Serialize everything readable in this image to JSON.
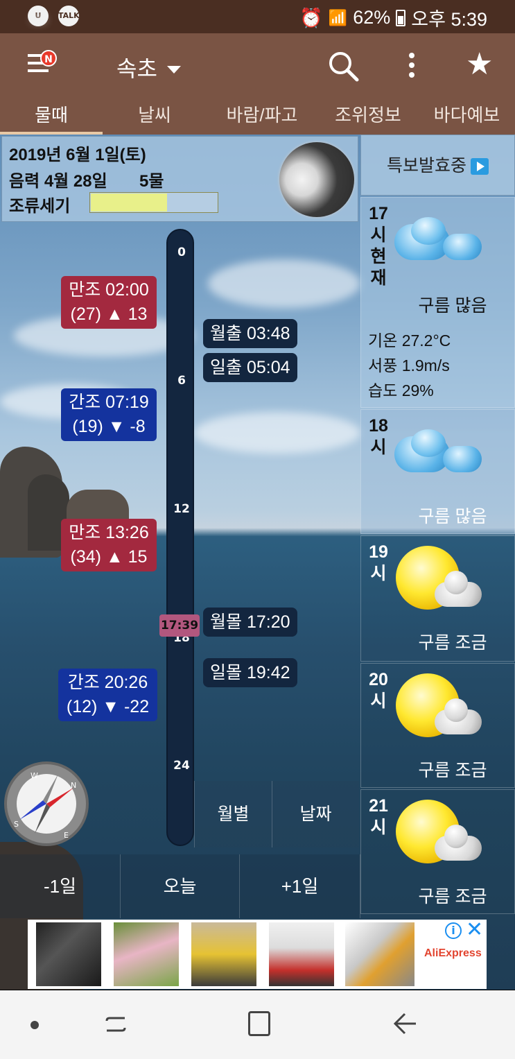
{
  "status_bar": {
    "left_icons": [
      "U",
      "cloud",
      "TALK"
    ],
    "battery": "62%",
    "time": "오후 5:39"
  },
  "app_bar": {
    "badge": "N",
    "location": "속초"
  },
  "tabs": [
    {
      "label": "물때",
      "active": true
    },
    {
      "label": "날씨"
    },
    {
      "label": "바람/파고"
    },
    {
      "label": "조위정보"
    },
    {
      "label": "바다예보"
    }
  ],
  "info": {
    "date": "2019년 6월 1일(토)",
    "lunar": "음력 4월 28일",
    "tide_phase": "5물",
    "strength_label": "조류세기",
    "strength_fraction": 0.6
  },
  "timeline": {
    "ticks": [
      "0",
      "6",
      "12",
      "18",
      "24"
    ],
    "now": "17:39"
  },
  "tides": [
    {
      "type": "high",
      "line1": "만조 02:00",
      "line2": "(27) ▲ 13"
    },
    {
      "type": "low",
      "line1": "간조 07:19",
      "line2": "(19) ▼ -8"
    },
    {
      "type": "high",
      "line1": "만조 13:26",
      "line2": "(34) ▲ 15"
    },
    {
      "type": "low",
      "line1": "간조 20:26",
      "line2": "(12) ▼ -22"
    }
  ],
  "astro": [
    "월출 03:48",
    "일출 05:04",
    "월몰 17:20",
    "일몰 19:42"
  ],
  "side_buttons": {
    "monthly": "월별",
    "date": "날짜"
  },
  "day_nav": {
    "prev": "-1일",
    "today": "오늘",
    "next": "+1일"
  },
  "weather": {
    "alert": "특보발효중",
    "current": {
      "hour": "17",
      "hour_suffix": "시",
      "now_chars": [
        "현",
        "재"
      ],
      "icon": "cloudy-icon",
      "condition": "구름 많음",
      "temp": "기온 27.2°C",
      "wind": "서풍 1.9m/s",
      "humidity": "습도 29%"
    },
    "hours": [
      {
        "hour": "18",
        "suffix": "시",
        "icon": "cloudy-icon",
        "condition": "구름 많음"
      },
      {
        "hour": "19",
        "suffix": "시",
        "icon": "sun-cloud-icon",
        "condition": "구름 조금"
      },
      {
        "hour": "20",
        "suffix": "시",
        "icon": "sun-cloud-icon",
        "condition": "구름 조금"
      },
      {
        "hour": "21",
        "suffix": "시",
        "icon": "sun-cloud-icon",
        "condition": "구름 조금"
      }
    ]
  },
  "ad": {
    "brand": "AliExpress",
    "info": "i",
    "close": "✕"
  },
  "colors": {
    "appbar": "#7a5444",
    "statusbar": "#4a2e22",
    "high_tide": "#a3293f",
    "low_tide": "#14339e",
    "timeline": "#13263f"
  }
}
